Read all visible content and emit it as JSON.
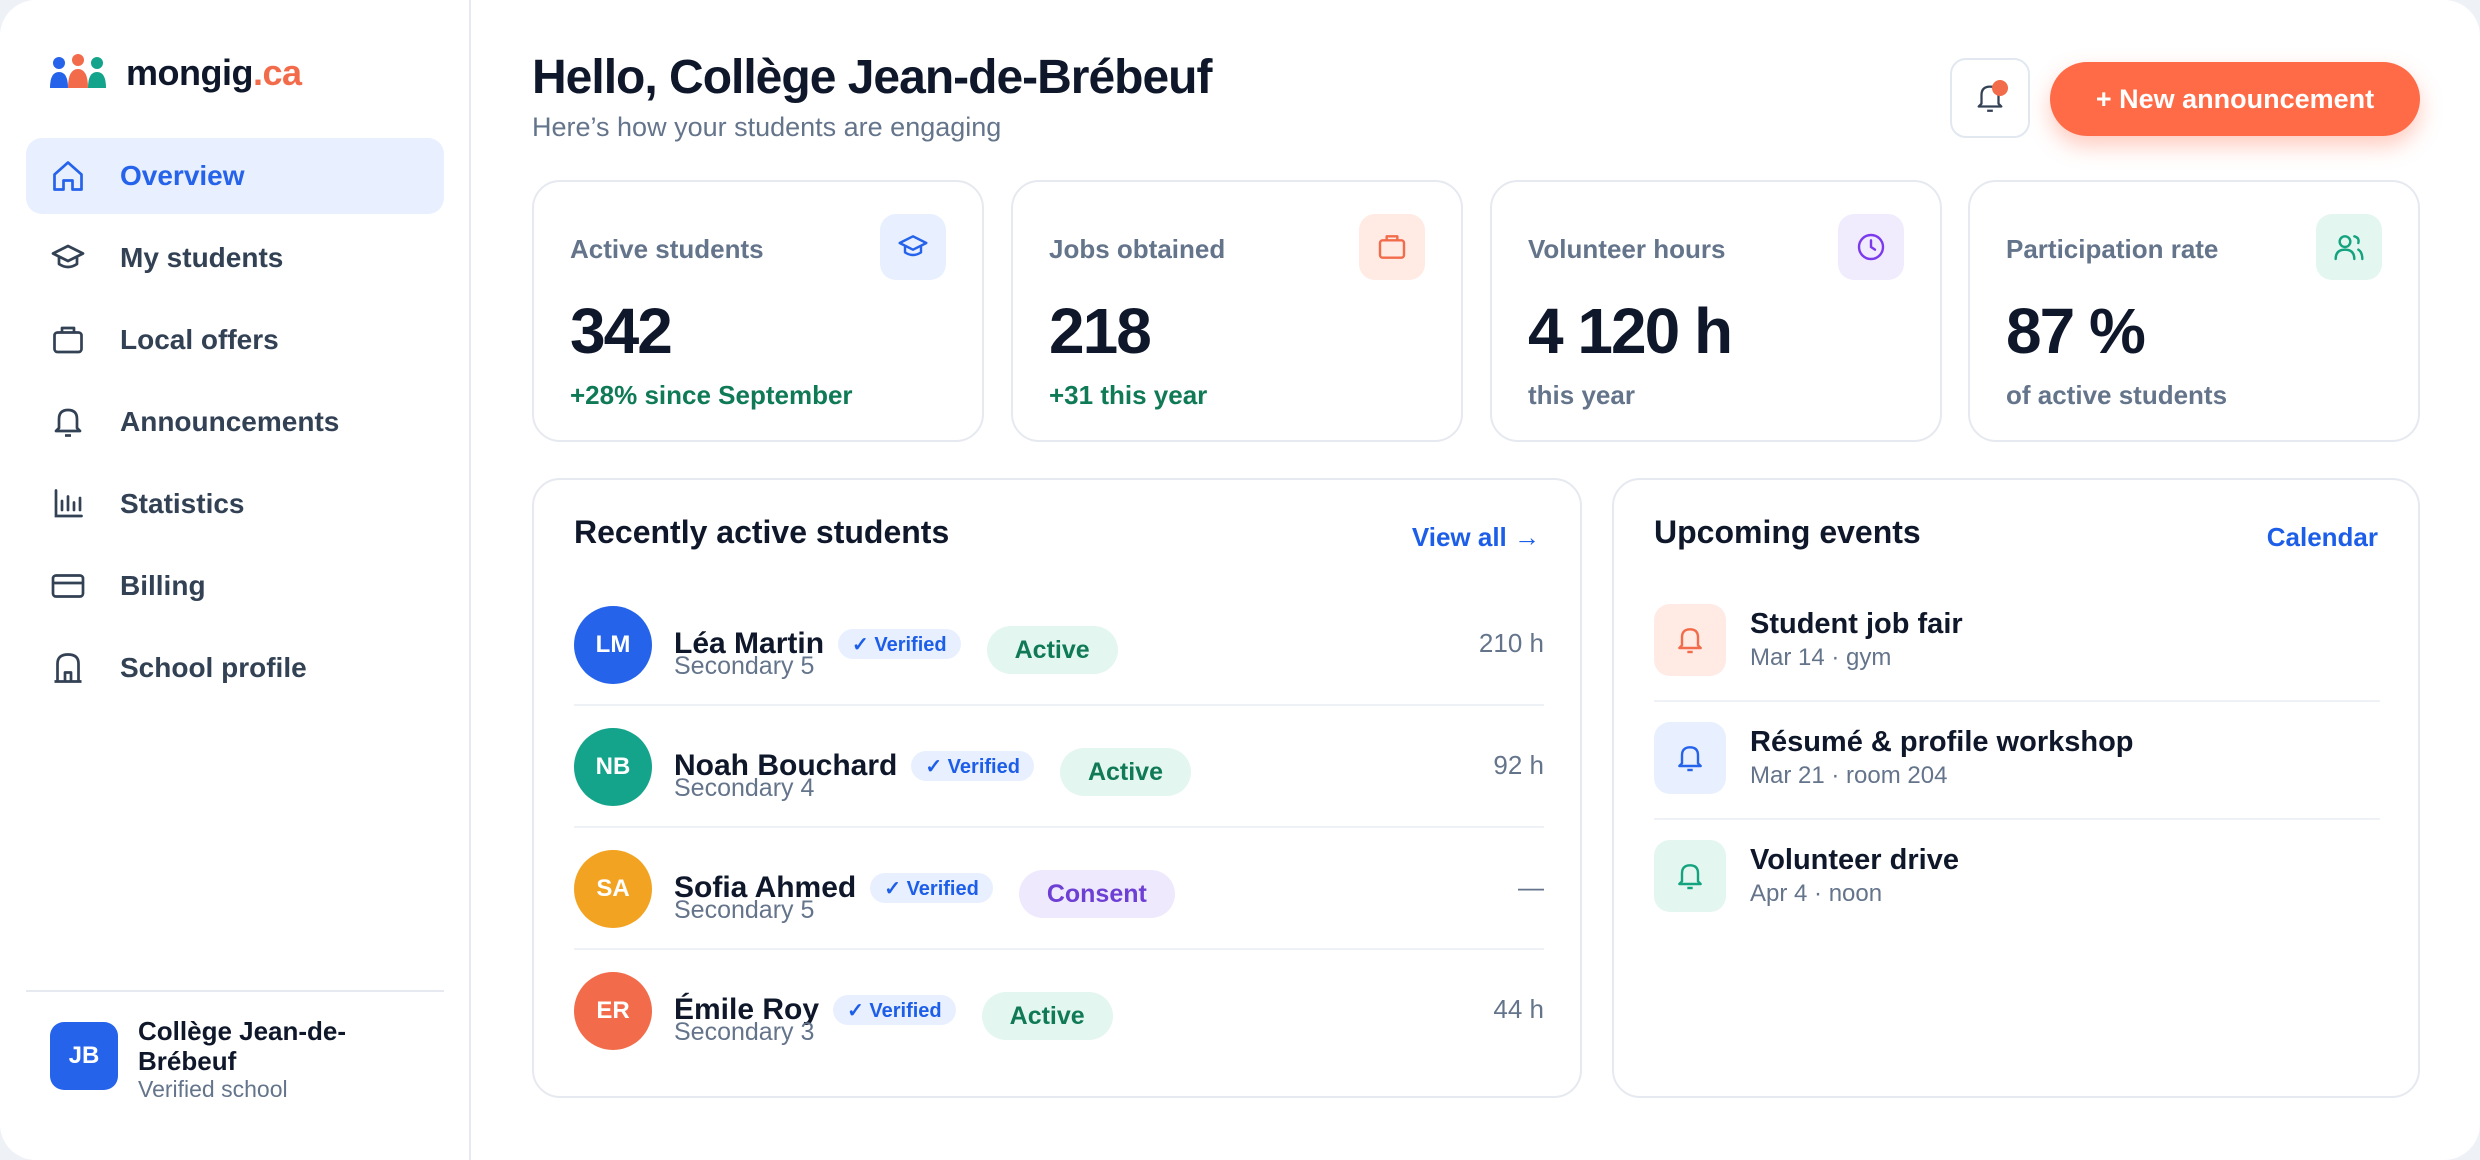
{
  "brand": {
    "name": "mongig",
    "tld": ".ca"
  },
  "sidebar": {
    "items": [
      {
        "label": "Overview",
        "icon": "home-icon",
        "active": true
      },
      {
        "label": "My students",
        "icon": "graduation-cap-icon"
      },
      {
        "label": "Local offers",
        "icon": "briefcase-icon"
      },
      {
        "label": "Announcements",
        "icon": "bell-icon"
      },
      {
        "label": "Statistics",
        "icon": "bar-chart-icon"
      },
      {
        "label": "Billing",
        "icon": "credit-card-icon"
      },
      {
        "label": "School profile",
        "icon": "school-building-icon"
      }
    ],
    "school": {
      "initials": "JB",
      "name": "Collège Jean-de-Brébeuf",
      "status": "Verified school"
    }
  },
  "header": {
    "greeting": "Hello, Collège Jean-de-Brébeuf",
    "subtitle": "Here’s how your students are engaging",
    "new_button": "+ New announcement"
  },
  "stats": [
    {
      "label": "Active students",
      "value": "342",
      "foot": "+28% since September",
      "foot_color": "#0f7a55",
      "icon": "graduation-cap-icon",
      "icon_bg": "#e8efff",
      "icon_color": "#2563eb"
    },
    {
      "label": "Jobs obtained",
      "value": "218",
      "foot": "+31 this year",
      "foot_color": "#0f7a55",
      "icon": "briefcase-icon",
      "icon_bg": "#ffeae4",
      "icon_color": "#f26b4a"
    },
    {
      "label": "Volunteer hours",
      "value": "4 120 h",
      "foot": "this year",
      "foot_color": "#64748b",
      "icon": "clock-icon",
      "icon_bg": "#f1ecfd",
      "icon_color": "#7c3aed"
    },
    {
      "label": "Participation rate",
      "value": "87 %",
      "foot": "of active students",
      "foot_color": "#64748b",
      "icon": "users-icon",
      "icon_bg": "#e3f6ef",
      "icon_color": "#14a37f"
    }
  ],
  "students_panel": {
    "title": "Recently active students",
    "link": "View all →",
    "verified_label": "✓ Verified",
    "rows": [
      {
        "initials": "LM",
        "name": "Léa Martin",
        "grade": "Secondary 5",
        "status": "Active",
        "status_type": "active",
        "hours": "210 h",
        "color": "#2563eb"
      },
      {
        "initials": "NB",
        "name": "Noah Bouchard",
        "grade": "Secondary 4",
        "status": "Active",
        "status_type": "active",
        "hours": "92 h",
        "color": "#14a38b"
      },
      {
        "initials": "SA",
        "name": "Sofia Ahmed",
        "grade": "Secondary 5",
        "status": "Consent",
        "status_type": "consent",
        "hours": "—",
        "color": "#f3a322"
      },
      {
        "initials": "ER",
        "name": "Émile Roy",
        "grade": "Secondary 3",
        "status": "Active",
        "status_type": "active",
        "hours": "44 h",
        "color": "#f26b4a"
      }
    ]
  },
  "events_panel": {
    "title": "Upcoming events",
    "link": "Calendar",
    "rows": [
      {
        "title": "Student job fair",
        "sub": "Mar 14 · gym",
        "icon": "bell-icon",
        "bg": "#ffeae4",
        "color": "#f26b4a"
      },
      {
        "title": "Résumé & profile workshop",
        "sub": "Mar 21 · room 204",
        "icon": "bell-icon",
        "bg": "#e8efff",
        "color": "#2563eb"
      },
      {
        "title": "Volunteer drive",
        "sub": "Apr 4 · noon",
        "icon": "bell-icon",
        "bg": "#e3f6ef",
        "color": "#14a37f"
      }
    ]
  }
}
